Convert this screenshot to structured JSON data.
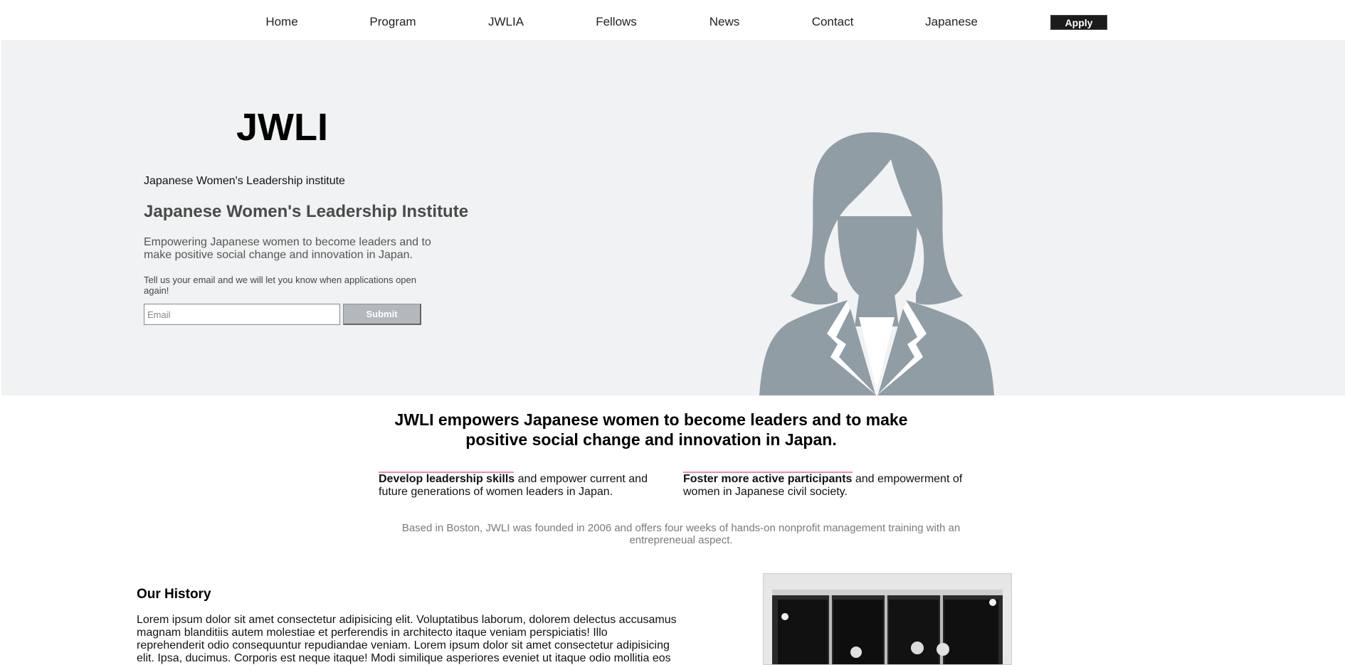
{
  "nav": {
    "items": [
      {
        "label": "Home"
      },
      {
        "label": "Program"
      },
      {
        "label": "JWLIA"
      },
      {
        "label": "Fellows"
      },
      {
        "label": "News"
      },
      {
        "label": "Contact"
      },
      {
        "label": "Japanese"
      }
    ],
    "apply_label": "Apply"
  },
  "hero": {
    "logo": "JWLI",
    "tagline_small": "Japanese Women's Leadership institute",
    "tagline_big": "Japanese Women's Leadership Institute",
    "description": "Empowering Japanese women to become leaders and to make positive social change and innovation in Japan.",
    "notify_text": "Tell us your email and we will let you know when applications open again!",
    "email_placeholder": "Email",
    "submit_label": "Submit",
    "silhouette_color": "#919da5"
  },
  "mission": {
    "headline": "JWLI empowers Japanese women to become leaders and to make positive social change and innovation in Japan.",
    "pillars": [
      {
        "bold": "Develop leadership skills",
        "rest": " and empower current and future generations of women leaders in Japan."
      },
      {
        "bold": "Foster more active participants",
        "rest": " and empowerment of women in Japanese civil society."
      }
    ],
    "accent_color": "#f08cab",
    "boston_text": "Based in Boston, JWLI was founded in 2006 and offers four weeks of hands-on nonprofit management training with an entrepreneual aspect."
  },
  "history": {
    "title": "Our History",
    "body": "Lorem ipsum dolor sit amet consectetur adipisicing elit. Voluptatibus laborum, dolorem delectus accusamus magnam blanditiis autem molestiae et perferendis in architecto itaque veniam perspiciatis! Illo reprehenderit odio consequuntur repudiandae veniam. Lorem ipsum dolor sit amet consectetur adipisicing elit. Ipsa, ducimus. Corporis est neque itaque! Modi similique asperiores eveniet ut itaque odio mollitia eos"
  }
}
